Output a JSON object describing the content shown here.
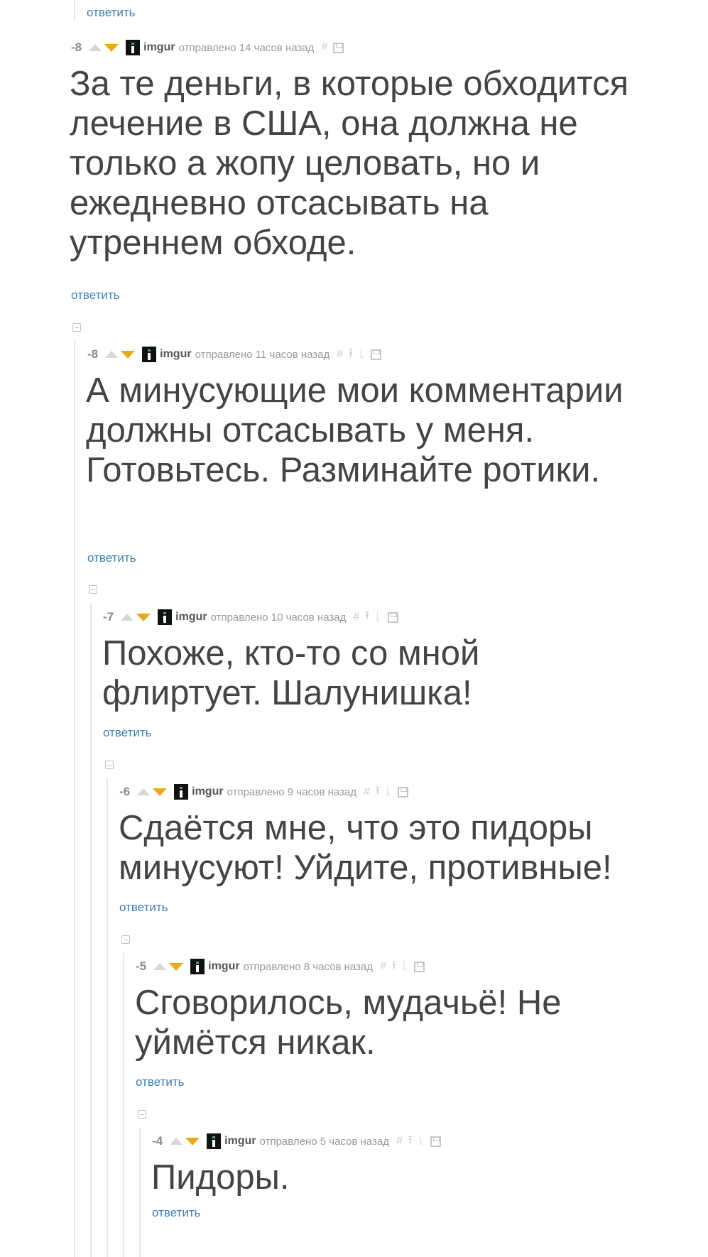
{
  "top": {
    "reply": "ответить"
  },
  "comments": [
    {
      "score": "-8",
      "user": "imgur",
      "time": "отправлено 14 часов назад",
      "text": "За те деньги, в которые обходится лечение в США, она должна не только а жопу целовать, но и ежедневно отсасывать на утреннем обходе.",
      "reply": "ответить"
    },
    {
      "score": "-8",
      "user": "imgur",
      "time": "отправлено 11 часов назад",
      "text": "А минусующие мои комментарии должны отсасывать у меня. Готовьтесь. Разминайте ротики.",
      "reply": "ответить"
    },
    {
      "score": "-7",
      "user": "imgur",
      "time": "отправлено 10 часов назад",
      "text": "Похоже, кто-то со мной флиртует. Шалунишка!",
      "reply": "ответить"
    },
    {
      "score": "-6",
      "user": "imgur",
      "time": "отправлено 9 часов назад",
      "text": "Сдаётся мне, что это пидоры минусуют! Уйдите, противные!",
      "reply": "ответить"
    },
    {
      "score": "-5",
      "user": "imgur",
      "time": "отправлено 8 часов назад",
      "text": "Сговорилось, мудачьё! Не уймётся никак.",
      "reply": "ответить"
    },
    {
      "score": "-4",
      "user": "imgur",
      "time": "отправлено 5 часов назад",
      "text": "Пидоры.",
      "reply": "ответить"
    }
  ],
  "icons": {
    "hash": "#",
    "parent": "⭱",
    "tree": "ᚳ",
    "save": "save-icon"
  },
  "colors": {
    "reply_link": "#3d7fb0",
    "vote_down": "#e8a917",
    "vote_up": "#d6d6d6"
  }
}
